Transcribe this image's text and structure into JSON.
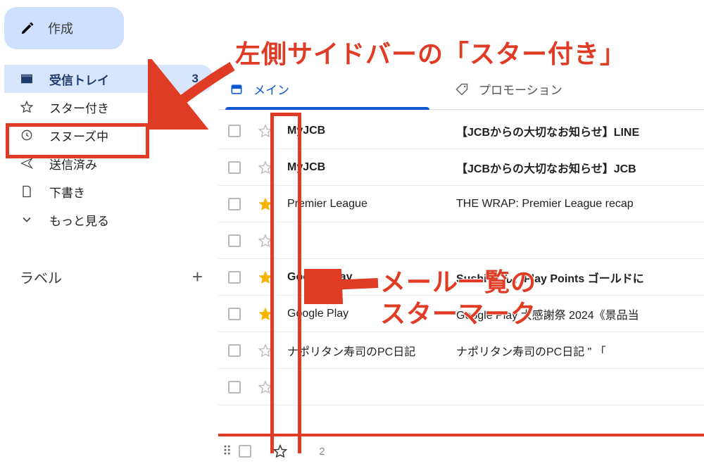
{
  "compose": "作成",
  "sidebar": {
    "items": [
      {
        "label": "受信トレイ",
        "count": "3"
      },
      {
        "label": "スター付き"
      },
      {
        "label": "スヌーズ中"
      },
      {
        "label": "送信済み"
      },
      {
        "label": "下書き"
      },
      {
        "label": "もっと見る"
      }
    ],
    "labels_header": "ラベル"
  },
  "tabs": [
    {
      "label": "メイン"
    },
    {
      "label": "プロモーション"
    }
  ],
  "mails": [
    {
      "sender": "MyJCB",
      "subject": "【JCBからの大切なお知らせ】LINE",
      "starred": false,
      "bold": true
    },
    {
      "sender": "MyJCB",
      "subject": "【JCBからの大切なお知らせ】JCB",
      "starred": false,
      "bold": true
    },
    {
      "sender": "Premier League",
      "subject": "THE WRAP: Premier League recap",
      "starred": true,
      "bold": false
    },
    {
      "sender": "",
      "subject": "",
      "starred": false,
      "bold": false
    },
    {
      "sender": "Google Play",
      "subject": "Sushi さん、Play Points ゴールドに",
      "starred": true,
      "bold": true
    },
    {
      "sender": "Google Play",
      "subject": "Google Play 大感謝祭 2024《景品当",
      "starred": true,
      "bold": false
    },
    {
      "sender": "ナポリタン寿司のPC日記",
      "subject": "ナポリタン寿司のPC日記 \" 「",
      "starred": false,
      "bold": false
    },
    {
      "sender": "",
      "subject": "",
      "starred": false,
      "bold": false
    }
  ],
  "footer_page": "2",
  "annotations": {
    "sidebar": "左側サイドバーの「スター付き」",
    "list": "メール一覧の\nスターマーク"
  }
}
